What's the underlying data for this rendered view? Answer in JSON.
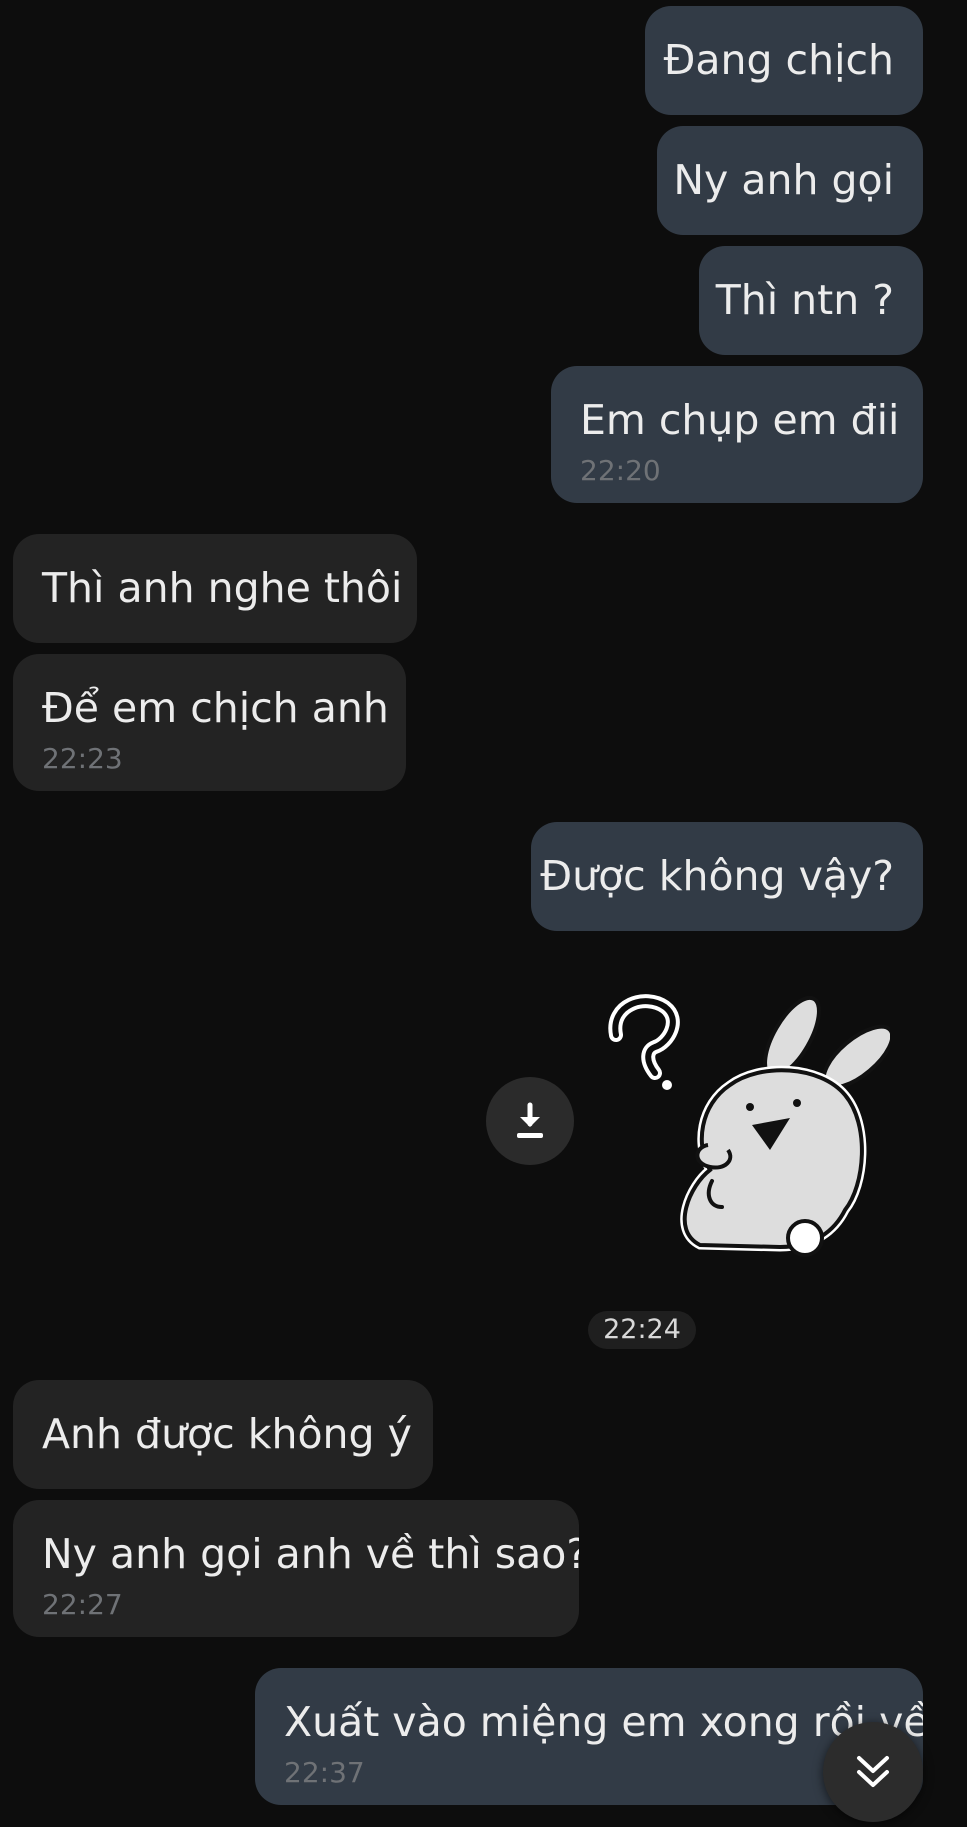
{
  "messages": [
    {
      "text": "Đang chịch"
    },
    {
      "text": "Ny anh gọi"
    },
    {
      "text": "Thì ntn ?"
    },
    {
      "text": "Em chụp em đii",
      "time": "22:20"
    },
    {
      "text": "Thì anh nghe thôi"
    },
    {
      "text": "Để em chịch anh",
      "time": "22:23"
    },
    {
      "text": "Được không vậy?"
    },
    {
      "text": "Anh được không ý"
    },
    {
      "text": "Ny anh gọi anh về thì sao?",
      "time": "22:27"
    },
    {
      "text": "Xuất vào miệng em xong rồi về",
      "time": "22:37"
    }
  ],
  "sticker": {
    "icon": "question-bunny-sticker",
    "time": "22:24"
  },
  "icons": {
    "download": "download-icon",
    "scroll_down": "double-chevron-down-icon"
  },
  "colors": {
    "background": "#0d0d0d",
    "outgoing": "#323b46",
    "incoming": "#232323"
  }
}
